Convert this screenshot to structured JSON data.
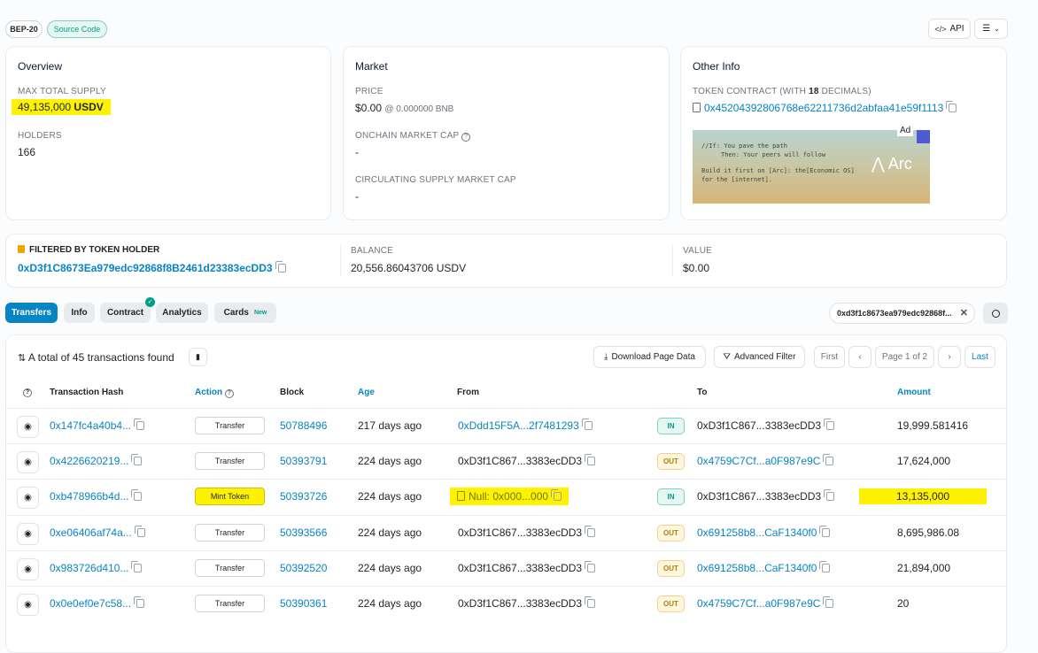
{
  "header": {
    "badge_bep": "BEP-20",
    "badge_source": "Source Code",
    "api_label": "API"
  },
  "overview": {
    "title": "Overview",
    "max_supply_label": "MAX TOTAL SUPPLY",
    "max_supply_value": "49,135,000",
    "max_supply_unit": "USDV",
    "holders_label": "HOLDERS",
    "holders_value": "166"
  },
  "market": {
    "title": "Market",
    "price_label": "PRICE",
    "price_value": "$0.00",
    "price_bnb": "@ 0.000000 BNB",
    "onchain_label": "ONCHAIN MARKET CAP",
    "onchain_value": "-",
    "circ_label": "CIRCULATING SUPPLY MARKET CAP",
    "circ_value": "-"
  },
  "other": {
    "title": "Other Info",
    "contract_label_pre": "TOKEN CONTRACT (WITH ",
    "contract_decimals": "18",
    "contract_label_post": " DECIMALS)",
    "contract_address": "0x45204392806768e62211736d2abfaa41e59f1113",
    "ad_tag": "Ad",
    "ad_line1": "//If: You pave the path",
    "ad_line2": "Then: Your peers will follow",
    "ad_line3": "Build it first on [Arc]: the[Economic OS]",
    "ad_line4": "for the [internet].",
    "ad_brand": "Arc"
  },
  "filter": {
    "holder_label": "FILTERED BY TOKEN HOLDER",
    "holder_address": "0xD3f1C8673Ea979edc92868f8B2461d23383ecDD3",
    "balance_label": "BALANCE",
    "balance_value": "20,556.86043706 USDV",
    "value_label": "VALUE",
    "value_value": "$0.00"
  },
  "tabs": [
    {
      "label": "Transfers"
    },
    {
      "label": "Info"
    },
    {
      "label": "Contract"
    },
    {
      "label": "Analytics"
    },
    {
      "label": "Cards"
    }
  ],
  "cards_new": "New",
  "search_chip": "0xd3f1c8673ea979edc92868f...",
  "table_toolbar": {
    "total_text": "A total of 45 transactions found",
    "download": "Download Page Data",
    "advanced": "Advanced Filter",
    "first": "First",
    "page": "Page 1 of 2",
    "last": "Last"
  },
  "columns": {
    "hash": "Transaction Hash",
    "action": "Action",
    "block": "Block",
    "age": "Age",
    "from": "From",
    "to": "To",
    "amount": "Amount"
  },
  "rows": [
    {
      "hash": "0x147fc4a40b4...",
      "action": "Transfer",
      "block": "50788496",
      "age": "217 days ago",
      "from": "0xDdd15F5A...2f7481293",
      "dir": "IN",
      "to": "0xD3f1C867...3383ecDD3",
      "amount": "19,999.581416"
    },
    {
      "hash": "0x4226620219...",
      "action": "Transfer",
      "block": "50393791",
      "age": "224 days ago",
      "from": "0xD3f1C867...3383ecDD3",
      "dir": "OUT",
      "to": "0x4759C7Cf...a0F987e9C",
      "amount": "17,624,000"
    },
    {
      "hash": "0xb478966b4d...",
      "action": "Mint Token",
      "block": "50393726",
      "age": "224 days ago",
      "from": "Null: 0x000...000",
      "dir": "IN",
      "to": "0xD3f1C867...3383ecDD3",
      "amount": "13,135,000"
    },
    {
      "hash": "0xe06406af74a...",
      "action": "Transfer",
      "block": "50393566",
      "age": "224 days ago",
      "from": "0xD3f1C867...3383ecDD3",
      "dir": "OUT",
      "to": "0x691258b8...CaF1340f0",
      "amount": "8,695,986.08"
    },
    {
      "hash": "0x983726d410...",
      "action": "Transfer",
      "block": "50392520",
      "age": "224 days ago",
      "from": "0xD3f1C867...3383ecDD3",
      "dir": "OUT",
      "to": "0x691258b8...CaF1340f0",
      "amount": "21,894,000"
    },
    {
      "hash": "0x0e0ef0e7c58...",
      "action": "Transfer",
      "block": "50390361",
      "age": "224 days ago",
      "from": "0xD3f1C867...3383ecDD3",
      "dir": "OUT",
      "to": "0x4759C7Cf...a0F987e9C",
      "amount": "20"
    }
  ]
}
